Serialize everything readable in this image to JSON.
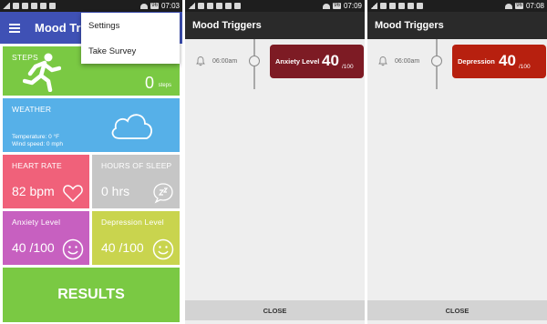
{
  "status": {
    "time1": "07:03",
    "time2": "07:09",
    "time3": "07:08",
    "battery": "96"
  },
  "app": {
    "title_partial": "Mood Trig",
    "title": "Mood Triggers"
  },
  "menu": {
    "items": [
      "Settings",
      "Take Survey"
    ]
  },
  "dashboard": {
    "steps": {
      "label": "STEPS",
      "value": "0",
      "unit": "steps"
    },
    "weather": {
      "label": "WEATHER",
      "temperature": "Temperature: 0 °F",
      "wind": "Wind speed: 0 mph"
    },
    "heart": {
      "label": "HEART RATE",
      "value": "82 bpm"
    },
    "sleep": {
      "label": "HOURS OF SLEEP",
      "value": "0 hrs"
    },
    "anxiety": {
      "label": "Anxiety Level",
      "value": "40 /100"
    },
    "depression": {
      "label": "Depression Level",
      "value": "40 /100"
    },
    "results_label": "RESULTS"
  },
  "triggers": [
    {
      "time": "06:00am",
      "name": "Anxiety Level",
      "level": "40",
      "denominator": "/100",
      "color": "#7d1b24"
    },
    {
      "time": "06:00am",
      "name": "Depression",
      "level": "40",
      "denominator": "/100",
      "color": "#b7200f"
    }
  ],
  "close_label": "CLOSE",
  "colors": {
    "appbar": "#3f51b5",
    "green": "#7ac943",
    "blue": "#56b0e8",
    "pink": "#f0617a",
    "gray": "#c6c6c6",
    "purple": "#c760c0",
    "olive": "#c9d44e"
  }
}
